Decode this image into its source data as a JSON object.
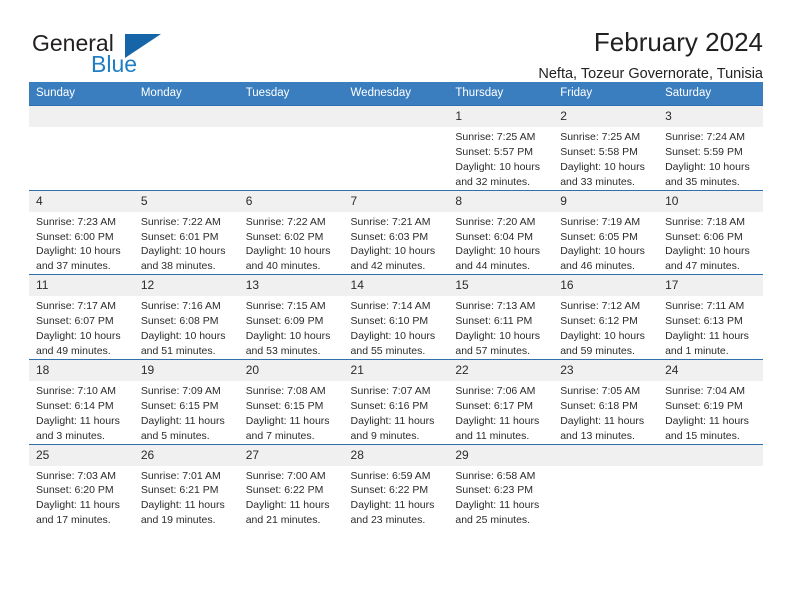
{
  "brand": {
    "name_part1": "General",
    "name_part2": "Blue",
    "triangle_color": "#1565a8",
    "blue_text_color": "#1f7ec4"
  },
  "header": {
    "title": "February 2024",
    "subtitle": "Nefta, Tozeur Governorate, Tunisia",
    "header_bg_color": "#3a7ebf",
    "row_divider_color": "#2f6fae",
    "daynum_bg_color": "#f0f0f0"
  },
  "weekday_headers": [
    "Sunday",
    "Monday",
    "Tuesday",
    "Wednesday",
    "Thursday",
    "Friday",
    "Saturday"
  ],
  "labels": {
    "sunrise_prefix": "Sunrise:",
    "sunset_prefix": "Sunset:",
    "daylight_prefix": "Daylight:"
  },
  "weeks": [
    [
      {
        "day": "",
        "lines": []
      },
      {
        "day": "",
        "lines": []
      },
      {
        "day": "",
        "lines": []
      },
      {
        "day": "",
        "lines": []
      },
      {
        "day": "1",
        "lines": [
          "Sunrise: 7:25 AM",
          "Sunset: 5:57 PM",
          "Daylight: 10 hours",
          "and 32 minutes."
        ]
      },
      {
        "day": "2",
        "lines": [
          "Sunrise: 7:25 AM",
          "Sunset: 5:58 PM",
          "Daylight: 10 hours",
          "and 33 minutes."
        ]
      },
      {
        "day": "3",
        "lines": [
          "Sunrise: 7:24 AM",
          "Sunset: 5:59 PM",
          "Daylight: 10 hours",
          "and 35 minutes."
        ]
      }
    ],
    [
      {
        "day": "4",
        "lines": [
          "Sunrise: 7:23 AM",
          "Sunset: 6:00 PM",
          "Daylight: 10 hours",
          "and 37 minutes."
        ]
      },
      {
        "day": "5",
        "lines": [
          "Sunrise: 7:22 AM",
          "Sunset: 6:01 PM",
          "Daylight: 10 hours",
          "and 38 minutes."
        ]
      },
      {
        "day": "6",
        "lines": [
          "Sunrise: 7:22 AM",
          "Sunset: 6:02 PM",
          "Daylight: 10 hours",
          "and 40 minutes."
        ]
      },
      {
        "day": "7",
        "lines": [
          "Sunrise: 7:21 AM",
          "Sunset: 6:03 PM",
          "Daylight: 10 hours",
          "and 42 minutes."
        ]
      },
      {
        "day": "8",
        "lines": [
          "Sunrise: 7:20 AM",
          "Sunset: 6:04 PM",
          "Daylight: 10 hours",
          "and 44 minutes."
        ]
      },
      {
        "day": "9",
        "lines": [
          "Sunrise: 7:19 AM",
          "Sunset: 6:05 PM",
          "Daylight: 10 hours",
          "and 46 minutes."
        ]
      },
      {
        "day": "10",
        "lines": [
          "Sunrise: 7:18 AM",
          "Sunset: 6:06 PM",
          "Daylight: 10 hours",
          "and 47 minutes."
        ]
      }
    ],
    [
      {
        "day": "11",
        "lines": [
          "Sunrise: 7:17 AM",
          "Sunset: 6:07 PM",
          "Daylight: 10 hours",
          "and 49 minutes."
        ]
      },
      {
        "day": "12",
        "lines": [
          "Sunrise: 7:16 AM",
          "Sunset: 6:08 PM",
          "Daylight: 10 hours",
          "and 51 minutes."
        ]
      },
      {
        "day": "13",
        "lines": [
          "Sunrise: 7:15 AM",
          "Sunset: 6:09 PM",
          "Daylight: 10 hours",
          "and 53 minutes."
        ]
      },
      {
        "day": "14",
        "lines": [
          "Sunrise: 7:14 AM",
          "Sunset: 6:10 PM",
          "Daylight: 10 hours",
          "and 55 minutes."
        ]
      },
      {
        "day": "15",
        "lines": [
          "Sunrise: 7:13 AM",
          "Sunset: 6:11 PM",
          "Daylight: 10 hours",
          "and 57 minutes."
        ]
      },
      {
        "day": "16",
        "lines": [
          "Sunrise: 7:12 AM",
          "Sunset: 6:12 PM",
          "Daylight: 10 hours",
          "and 59 minutes."
        ]
      },
      {
        "day": "17",
        "lines": [
          "Sunrise: 7:11 AM",
          "Sunset: 6:13 PM",
          "Daylight: 11 hours",
          "and 1 minute."
        ]
      }
    ],
    [
      {
        "day": "18",
        "lines": [
          "Sunrise: 7:10 AM",
          "Sunset: 6:14 PM",
          "Daylight: 11 hours",
          "and 3 minutes."
        ]
      },
      {
        "day": "19",
        "lines": [
          "Sunrise: 7:09 AM",
          "Sunset: 6:15 PM",
          "Daylight: 11 hours",
          "and 5 minutes."
        ]
      },
      {
        "day": "20",
        "lines": [
          "Sunrise: 7:08 AM",
          "Sunset: 6:15 PM",
          "Daylight: 11 hours",
          "and 7 minutes."
        ]
      },
      {
        "day": "21",
        "lines": [
          "Sunrise: 7:07 AM",
          "Sunset: 6:16 PM",
          "Daylight: 11 hours",
          "and 9 minutes."
        ]
      },
      {
        "day": "22",
        "lines": [
          "Sunrise: 7:06 AM",
          "Sunset: 6:17 PM",
          "Daylight: 11 hours",
          "and 11 minutes."
        ]
      },
      {
        "day": "23",
        "lines": [
          "Sunrise: 7:05 AM",
          "Sunset: 6:18 PM",
          "Daylight: 11 hours",
          "and 13 minutes."
        ]
      },
      {
        "day": "24",
        "lines": [
          "Sunrise: 7:04 AM",
          "Sunset: 6:19 PM",
          "Daylight: 11 hours",
          "and 15 minutes."
        ]
      }
    ],
    [
      {
        "day": "25",
        "lines": [
          "Sunrise: 7:03 AM",
          "Sunset: 6:20 PM",
          "Daylight: 11 hours",
          "and 17 minutes."
        ]
      },
      {
        "day": "26",
        "lines": [
          "Sunrise: 7:01 AM",
          "Sunset: 6:21 PM",
          "Daylight: 11 hours",
          "and 19 minutes."
        ]
      },
      {
        "day": "27",
        "lines": [
          "Sunrise: 7:00 AM",
          "Sunset: 6:22 PM",
          "Daylight: 11 hours",
          "and 21 minutes."
        ]
      },
      {
        "day": "28",
        "lines": [
          "Sunrise: 6:59 AM",
          "Sunset: 6:22 PM",
          "Daylight: 11 hours",
          "and 23 minutes."
        ]
      },
      {
        "day": "29",
        "lines": [
          "Sunrise: 6:58 AM",
          "Sunset: 6:23 PM",
          "Daylight: 11 hours",
          "and 25 minutes."
        ]
      },
      {
        "day": "",
        "lines": []
      },
      {
        "day": "",
        "lines": []
      }
    ]
  ]
}
